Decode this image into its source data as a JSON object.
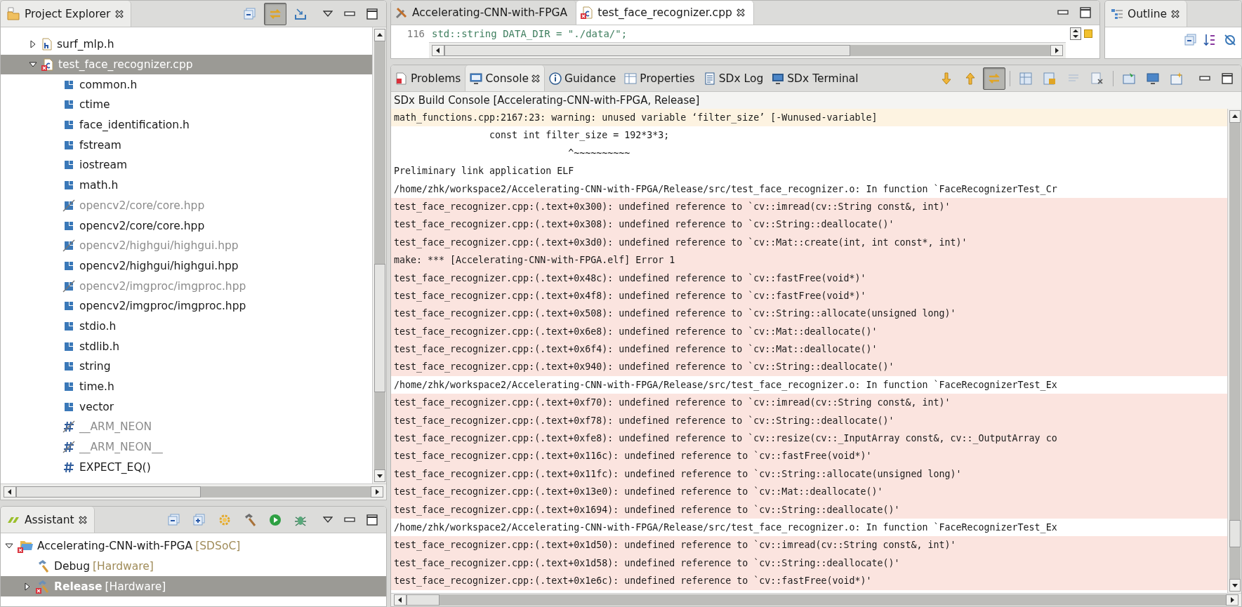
{
  "project_explorer": {
    "title": "Project Explorer",
    "toolbar": [
      {
        "kind": "collapse_all",
        "pressed": false
      },
      {
        "kind": "link",
        "pressed": true
      },
      {
        "kind": "import",
        "pressed": false
      }
    ],
    "tree": [
      {
        "label": "surf_mlp.h",
        "kind": "header_file",
        "expanded": false,
        "selected": false,
        "error": false
      },
      {
        "label": "test_face_recognizer.cpp",
        "kind": "source_file",
        "expanded": true,
        "selected": true,
        "error": true,
        "children": [
          {
            "label": "common.h",
            "kind": "include",
            "disabled": false,
            "selected": false
          },
          {
            "label": "ctime",
            "kind": "include",
            "disabled": false,
            "selected": false
          },
          {
            "label": "face_identification.h",
            "kind": "include",
            "disabled": false,
            "selected": false
          },
          {
            "label": "fstream",
            "kind": "include",
            "disabled": false,
            "selected": false
          },
          {
            "label": "iostream",
            "kind": "include",
            "disabled": false,
            "selected": false
          },
          {
            "label": "math.h",
            "kind": "include",
            "disabled": false,
            "selected": false
          },
          {
            "label": "opencv2/core/core.hpp",
            "kind": "include",
            "disabled": true,
            "selected": false
          },
          {
            "label": "opencv2/core/core.hpp",
            "kind": "include",
            "disabled": false,
            "selected": false
          },
          {
            "label": "opencv2/highgui/highgui.hpp",
            "kind": "include",
            "disabled": true,
            "selected": false
          },
          {
            "label": "opencv2/highgui/highgui.hpp",
            "kind": "include",
            "disabled": false,
            "selected": false
          },
          {
            "label": "opencv2/imgproc/imgproc.hpp",
            "kind": "include",
            "disabled": true,
            "selected": false
          },
          {
            "label": "opencv2/imgproc/imgproc.hpp",
            "kind": "include",
            "disabled": false,
            "selected": false
          },
          {
            "label": "stdio.h",
            "kind": "include",
            "disabled": false,
            "selected": false
          },
          {
            "label": "stdlib.h",
            "kind": "include",
            "disabled": false,
            "selected": false
          },
          {
            "label": "string",
            "kind": "include",
            "disabled": false,
            "selected": false
          },
          {
            "label": "time.h",
            "kind": "include",
            "disabled": false,
            "selected": false
          },
          {
            "label": "vector",
            "kind": "include",
            "disabled": false,
            "selected": false
          },
          {
            "label": "__ARM_NEON",
            "kind": "macro",
            "disabled": true,
            "selected": false
          },
          {
            "label": "__ARM_NEON__",
            "kind": "macro",
            "disabled": true,
            "selected": false
          },
          {
            "label": "EXPECT_EQ()",
            "kind": "macro",
            "disabled": false,
            "selected": false
          }
        ]
      }
    ]
  },
  "assistant": {
    "title": "Assistant",
    "toolbar": [
      {
        "kind": "collapse_all",
        "pressed": false
      },
      {
        "kind": "expand_all",
        "pressed": false
      },
      {
        "kind": "gear",
        "pressed": false
      },
      {
        "kind": "hammer",
        "pressed": false
      },
      {
        "kind": "run",
        "pressed": false
      },
      {
        "kind": "bug",
        "pressed": false
      }
    ],
    "tree": [
      {
        "label": "Accelerating-CNN-with-FPGA",
        "tag": "[SDSoC]",
        "kind": "project",
        "expanded": true,
        "selected": false,
        "error": true,
        "children": [
          {
            "label": "Debug",
            "tag": "[Hardware]",
            "kind": "build_config",
            "selected": false,
            "error": false
          },
          {
            "label": "Release",
            "tag": "[Hardware]",
            "kind": "build_config",
            "expanded": false,
            "selected": true,
            "error": true
          }
        ]
      }
    ]
  },
  "editor": {
    "tabs": [
      {
        "label": "Accelerating-CNN-with-FPGA",
        "kind": "project_settings",
        "selected": false,
        "closable": false
      },
      {
        "label": "test_face_recognizer.cpp",
        "kind": "source_file",
        "selected": true,
        "closable": true
      }
    ],
    "lines": [
      {
        "number": "116",
        "code": "std::string DATA_DIR = \"./data/\";"
      }
    ]
  },
  "outline": {
    "title": "Outline"
  },
  "console_view": {
    "tabs": [
      {
        "label": "Problems",
        "kind": "problems",
        "selected": false,
        "closable": false
      },
      {
        "label": "Console",
        "kind": "console",
        "selected": true,
        "closable": true
      },
      {
        "label": "Guidance",
        "kind": "guidance",
        "selected": false,
        "closable": false
      },
      {
        "label": "Properties",
        "kind": "properties",
        "selected": false,
        "closable": false
      },
      {
        "label": "SDx Log",
        "kind": "log",
        "selected": false,
        "closable": false
      },
      {
        "label": "SDx Terminal",
        "kind": "terminal",
        "selected": false,
        "closable": false
      }
    ],
    "toolbar": [
      {
        "kind": "arrow_down",
        "pressed": false
      },
      {
        "kind": "arrow_up",
        "pressed": false
      },
      {
        "kind": "link",
        "pressed": true
      },
      {
        "kind": "separator"
      },
      {
        "kind": "grid",
        "pressed": false
      },
      {
        "kind": "lock",
        "pressed": false
      },
      {
        "kind": "lines",
        "pressed": false
      },
      {
        "kind": "clear",
        "pressed": false
      },
      {
        "kind": "separator"
      },
      {
        "kind": "pin",
        "pressed": false
      },
      {
        "kind": "monitor",
        "pressed": false
      },
      {
        "kind": "new_console",
        "pressed": false
      }
    ],
    "title": "SDx Build Console [Accelerating-CNN-with-FPGA, Release]",
    "lines": [
      {
        "kind": "warning",
        "text": "math_functions.cpp:2167:23: warning: unused variable ‘filter_size’ [-Wunused-variable]"
      },
      {
        "kind": "plain",
        "text": "                 const int filter_size = 192*3*3;"
      },
      {
        "kind": "plain",
        "text": "                               ^~~~~~~~~~~"
      },
      {
        "kind": "plain",
        "text": "Preliminary link application ELF"
      },
      {
        "kind": "plain",
        "text": "/home/zhk/workspace2/Accelerating-CNN-with-FPGA/Release/src/test_face_recognizer.o: In function `FaceRecognizerTest_Cr"
      },
      {
        "kind": "error",
        "text": "test_face_recognizer.cpp:(.text+0x300): undefined reference to `cv::imread(cv::String const&, int)'"
      },
      {
        "kind": "error",
        "text": "test_face_recognizer.cpp:(.text+0x308): undefined reference to `cv::String::deallocate()'"
      },
      {
        "kind": "error",
        "text": "test_face_recognizer.cpp:(.text+0x3d0): undefined reference to `cv::Mat::create(int, int const*, int)'"
      },
      {
        "kind": "error",
        "text": "make: *** [Accelerating-CNN-with-FPGA.elf] Error 1"
      },
      {
        "kind": "error",
        "text": "test_face_recognizer.cpp:(.text+0x48c): undefined reference to `cv::fastFree(void*)'"
      },
      {
        "kind": "error",
        "text": "test_face_recognizer.cpp:(.text+0x4f8): undefined reference to `cv::fastFree(void*)'"
      },
      {
        "kind": "error",
        "text": "test_face_recognizer.cpp:(.text+0x508): undefined reference to `cv::String::allocate(unsigned long)'"
      },
      {
        "kind": "error",
        "text": "test_face_recognizer.cpp:(.text+0x6e8): undefined reference to `cv::Mat::deallocate()'"
      },
      {
        "kind": "error",
        "text": "test_face_recognizer.cpp:(.text+0x6f4): undefined reference to `cv::Mat::deallocate()'"
      },
      {
        "kind": "error",
        "text": "test_face_recognizer.cpp:(.text+0x940): undefined reference to `cv::String::deallocate()'"
      },
      {
        "kind": "plain",
        "text": "/home/zhk/workspace2/Accelerating-CNN-with-FPGA/Release/src/test_face_recognizer.o: In function `FaceRecognizerTest_Ex"
      },
      {
        "kind": "error",
        "text": "test_face_recognizer.cpp:(.text+0xf70): undefined reference to `cv::imread(cv::String const&, int)'"
      },
      {
        "kind": "error",
        "text": "test_face_recognizer.cpp:(.text+0xf78): undefined reference to `cv::String::deallocate()'"
      },
      {
        "kind": "error",
        "text": "test_face_recognizer.cpp:(.text+0xfe8): undefined reference to `cv::resize(cv::_InputArray const&, cv::_OutputArray co"
      },
      {
        "kind": "error",
        "text": "test_face_recognizer.cpp:(.text+0x116c): undefined reference to `cv::fastFree(void*)'"
      },
      {
        "kind": "error",
        "text": "test_face_recognizer.cpp:(.text+0x11fc): undefined reference to `cv::String::allocate(unsigned long)'"
      },
      {
        "kind": "error",
        "text": "test_face_recognizer.cpp:(.text+0x13e0): undefined reference to `cv::Mat::deallocate()'"
      },
      {
        "kind": "error",
        "text": "test_face_recognizer.cpp:(.text+0x1694): undefined reference to `cv::String::deallocate()'"
      },
      {
        "kind": "plain",
        "text": "/home/zhk/workspace2/Accelerating-CNN-with-FPGA/Release/src/test_face_recognizer.o: In function `FaceRecognizerTest_Ex"
      },
      {
        "kind": "error",
        "text": "test_face_recognizer.cpp:(.text+0x1d50): undefined reference to `cv::imread(cv::String const&, int)'"
      },
      {
        "kind": "error",
        "text": "test_face_recognizer.cpp:(.text+0x1d58): undefined reference to `cv::String::deallocate()'"
      },
      {
        "kind": "error",
        "text": "test_face_recognizer.cpp:(.text+0x1e6c): undefined reference to `cv::fastFree(void*)'"
      }
    ]
  }
}
